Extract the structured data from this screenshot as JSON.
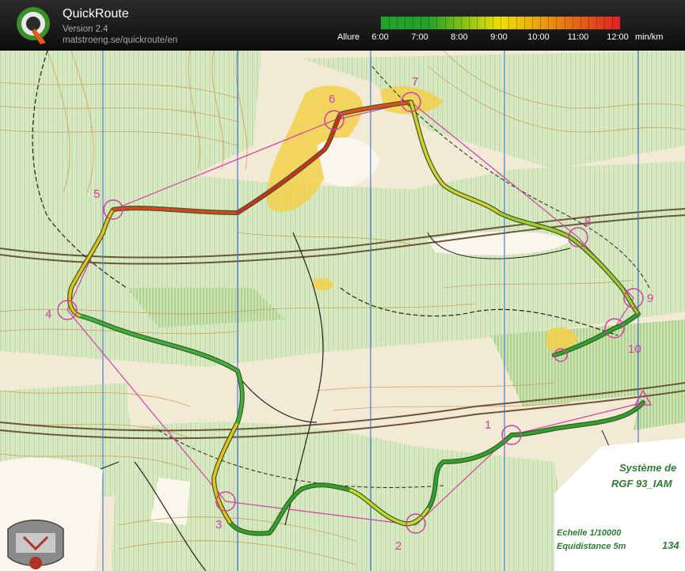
{
  "app": {
    "title": "QuickRoute",
    "version": "Version 2.4",
    "url": "matstroeng.se/quickroute/en"
  },
  "legend": {
    "label": "Allure",
    "unit": "min/km",
    "ticks": [
      "6:00",
      "7:00",
      "8:00",
      "9:00",
      "10:00",
      "11:00",
      "12:00"
    ],
    "colors": {
      "fast": "#22a22a",
      "medium": "#f0e000",
      "slow": "#e02020"
    }
  },
  "controls": [
    {
      "label": "1"
    },
    {
      "label": "2"
    },
    {
      "label": "3"
    },
    {
      "label": "4"
    },
    {
      "label": "5"
    },
    {
      "label": "6"
    },
    {
      "label": "7"
    },
    {
      "label": "8"
    },
    {
      "label": "9"
    },
    {
      "label": "10"
    }
  ],
  "map_text": {
    "system_line1": "Système de",
    "system_line2": "RGF 93_IAM",
    "scale": "Echelle 1/10000",
    "equidistance": "Equidistance 5m",
    "sheet_number": "134"
  },
  "colors": {
    "route_outline": "#3a5e24",
    "course": "#d43fa6",
    "north_lines": "#3b6fd6",
    "map_bg": "#f3ead6",
    "forest": "#d9e8c4",
    "open_yellow": "#f2d04a"
  }
}
